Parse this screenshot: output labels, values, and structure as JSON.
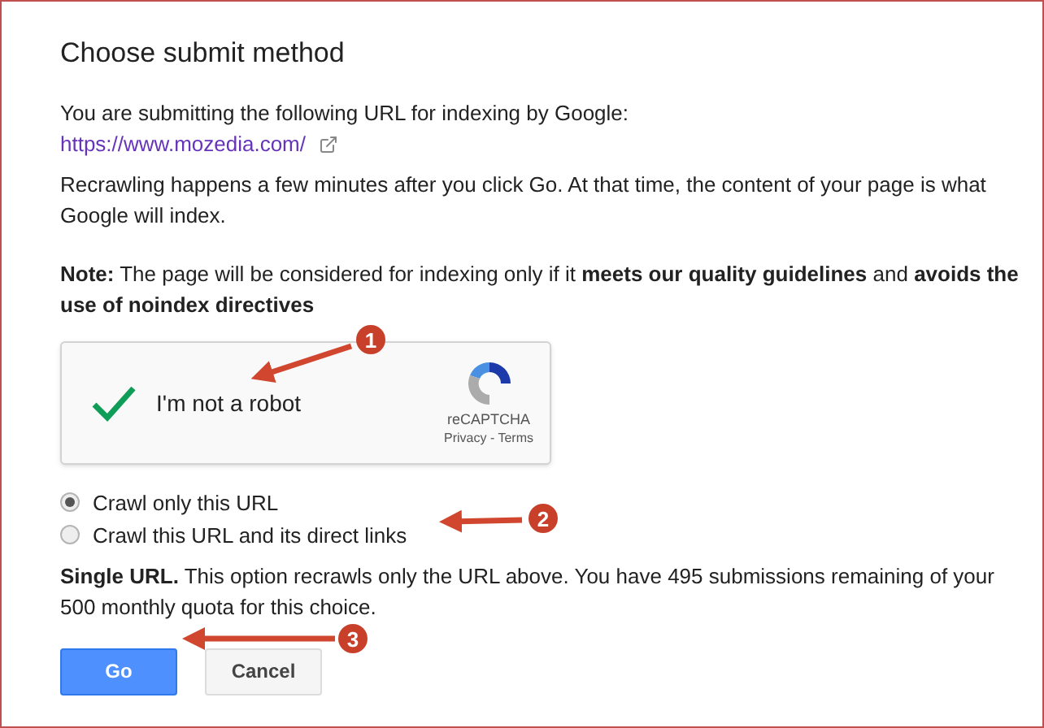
{
  "title": "Choose submit method",
  "intro": "You are submitting the following URL for indexing by Google:",
  "url": "https://www.mozedia.com/",
  "recrawl_note": "Recrawling happens a few minutes after you click Go. At that time, the content of your page is what Google will index.",
  "note": "**Note:** The page will be considered for indexing only if it **meets our quality guidelines** and **avoids the use of noindex directives**",
  "captcha": {
    "label": "I'm not a robot",
    "checked": true,
    "brand": "reCAPTCHA",
    "links": "Privacy - Terms"
  },
  "crawl_options": [
    {
      "label": "Crawl only this URL",
      "selected": true
    },
    {
      "label": "Crawl this URL and its direct links",
      "selected": false
    }
  ],
  "description": "**Single URL.** This option recrawls only the URL above. You have 495 submissions remaining of your 500 monthly quota for this choice.",
  "buttons": [
    {
      "label": "Go",
      "kind": "primary"
    },
    {
      "label": "Cancel",
      "kind": "secondary"
    }
  ],
  "annotations": [
    {
      "number": "1"
    },
    {
      "number": "2"
    },
    {
      "number": "3"
    }
  ]
}
